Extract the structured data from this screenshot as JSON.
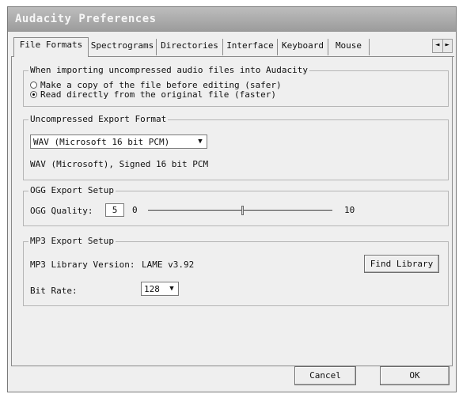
{
  "window": {
    "title": "Audacity Preferences"
  },
  "tabs": [
    {
      "label": "File Formats"
    },
    {
      "label": "Spectrograms"
    },
    {
      "label": "Directories"
    },
    {
      "label": "Interface"
    },
    {
      "label": "Keyboard"
    },
    {
      "label": "Mouse"
    }
  ],
  "tab_arrows": {
    "left": "◄",
    "right": "►"
  },
  "import_group": {
    "legend": "When importing uncompressed audio files into Audacity",
    "options": [
      {
        "label": "Make a copy of the file before editing (safer)",
        "selected": false
      },
      {
        "label": "Read directly from the original file (faster)",
        "selected": true
      }
    ]
  },
  "export_group": {
    "legend": "Uncompressed Export Format",
    "format_value": "WAV (Microsoft 16 bit PCM)",
    "description": "WAV (Microsoft), Signed 16 bit PCM"
  },
  "ogg_group": {
    "legend": "OGG Export Setup",
    "quality_label": "OGG Quality:",
    "quality_value": "5",
    "slider_min": "0",
    "slider_max": "10",
    "slider_value": 5
  },
  "mp3_group": {
    "legend": "MP3 Export Setup",
    "library_label": "MP3 Library Version:",
    "library_version": "LAME v3.92",
    "find_library_label": "Find Library",
    "bitrate_label": "Bit Rate:",
    "bitrate_value": "128"
  },
  "footer": {
    "cancel_label": "Cancel",
    "ok_label": "OK"
  },
  "icons": {
    "dropdown": "▼"
  }
}
